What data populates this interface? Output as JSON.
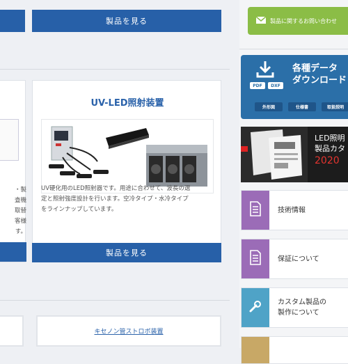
{
  "cards": {
    "left_partial": {
      "desc_lines": [
        "・製",
        "査機",
        "取替",
        "客様",
        "す。"
      ]
    },
    "top_center": {
      "button_label": "製品を見る"
    },
    "uv_led": {
      "title": "UV-LED照射装置",
      "desc_lines": [
        "UV硬化用のLED照射器です。用途に合わせて、波長の選",
        "定と照射強度設計を行います。空冷タイプ・水冷タイプ",
        "をラインナップしています。"
      ],
      "button_label": "製品を見る"
    }
  },
  "links": {
    "xenon": "キセノン管ストロボ装置"
  },
  "sidebar": {
    "contact_label": "製品に関するお問い合わせ",
    "download": {
      "title_line1": "各種データ",
      "title_line2": "ダウンロード",
      "file_tags": [
        "PDF",
        "DXF"
      ],
      "chips": [
        "外形図",
        "仕様書",
        "取扱説明"
      ]
    },
    "catalog": {
      "line1": "LED照明",
      "line2": "製品カタ",
      "year": "2020"
    },
    "items": [
      {
        "label": "技術情報",
        "icon": "document-icon",
        "color": "#9b6cb7"
      },
      {
        "label": "保証について",
        "icon": "document-icon",
        "color": "#9b6cb7"
      },
      {
        "label_line1": "カスタム製品の",
        "label_line2": "製作について",
        "icon": "wrench-icon",
        "color": "#4fa3c7"
      },
      {
        "icon": "folder-icon",
        "color": "#c8a866"
      }
    ]
  }
}
